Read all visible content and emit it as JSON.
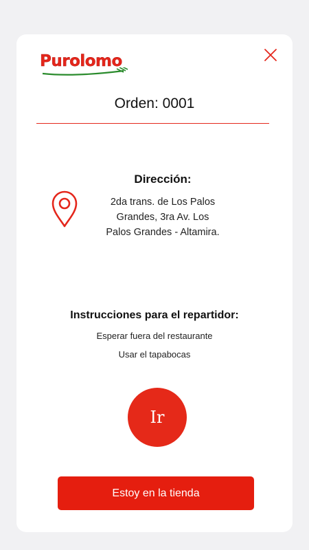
{
  "brand": {
    "logo_text": "Purolomo",
    "logo_color": "#e4261b",
    "swoosh_color": "#2a8b2c"
  },
  "header": {
    "close_icon": "close-icon"
  },
  "order": {
    "title": "Orden: 0001"
  },
  "address": {
    "heading": "Dirección:",
    "icon": "location-pin-icon",
    "text": "2da trans. de Los Palos Grandes, 3ra Av. Los Palos Grandes - Altamira."
  },
  "instructions": {
    "heading": "Instrucciones para el repartidor:",
    "items": [
      "Esperar fuera del restaurante",
      "Usar el tapabocas"
    ]
  },
  "actions": {
    "go_label": "Ir",
    "store_label": "Estoy en la tienda"
  },
  "colors": {
    "accent": "#e52919",
    "background": "#f1f1f3",
    "card": "#ffffff"
  }
}
